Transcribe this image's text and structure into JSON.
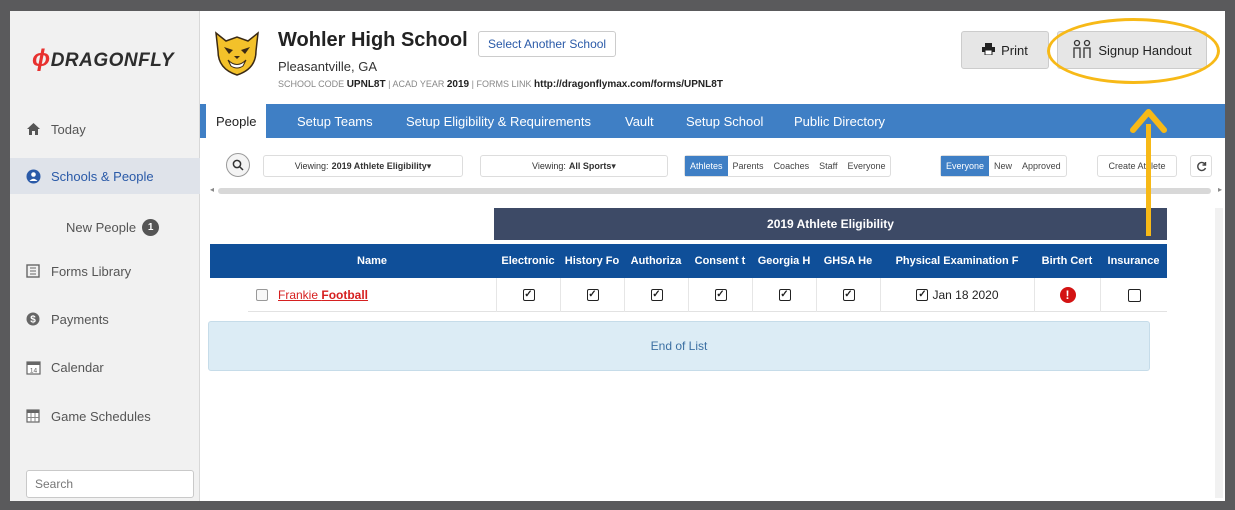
{
  "brand": {
    "logo": "DRAGONFLY"
  },
  "sidebar": {
    "items": [
      {
        "label": "Today",
        "icon": "home-icon"
      },
      {
        "label": "Schools & People",
        "icon": "user-circle-icon"
      },
      {
        "label": "New People",
        "badge": "1"
      },
      {
        "label": "Forms Library",
        "icon": "forms-icon"
      },
      {
        "label": "Payments",
        "icon": "dollar-icon"
      },
      {
        "label": "Calendar",
        "icon": "calendar-icon"
      },
      {
        "label": "Game Schedules",
        "icon": "schedule-icon"
      }
    ],
    "search_placeholder": "Search"
  },
  "header": {
    "school_name": "Wohler High School",
    "select_school_label": "Select Another School",
    "location": "Pleasantville, GA",
    "school_code_label": "SCHOOL CODE",
    "school_code": "UPNL8T",
    "acad_year_label": "ACAD YEAR",
    "acad_year": "2019",
    "forms_link_label": "FORMS LINK",
    "forms_link": "http://dragonflymax.com/forms/UPNL8T",
    "print_label": "Print",
    "signup_label": "Signup Handout"
  },
  "tabs": [
    "People",
    "Setup Teams",
    "Setup Eligibility & Requirements",
    "Vault",
    "Setup School",
    "Public Directory"
  ],
  "toolbar": {
    "viewing_label": "Viewing:",
    "viewing_eligibility": "2019 Athlete Eligibility",
    "viewing_sports": "All Sports",
    "role_filters": [
      "Athletes",
      "Parents",
      "Coaches",
      "Staff",
      "Everyone"
    ],
    "status_filters": [
      "Everyone",
      "New",
      "Approved"
    ],
    "create_label": "Create Athlete"
  },
  "grid": {
    "band_title": "2019 Athlete Eligibility",
    "columns": [
      "Name",
      "Electronic",
      "History Fo",
      "Authoriza",
      "Consent t",
      "Georgia H",
      "GHSA He",
      "Physical Examination F",
      "Birth Cert",
      "Insurance"
    ],
    "rows": [
      {
        "first": "Frankie",
        "last": "Football",
        "physical_date": "Jan 18 2020"
      }
    ],
    "end_label": "End of List"
  },
  "colors": {
    "accent": "#3f7fc5",
    "header_blue": "#0f4f99",
    "band": "#3d4a66",
    "highlight": "#f7b917",
    "alert": "#d31313"
  }
}
